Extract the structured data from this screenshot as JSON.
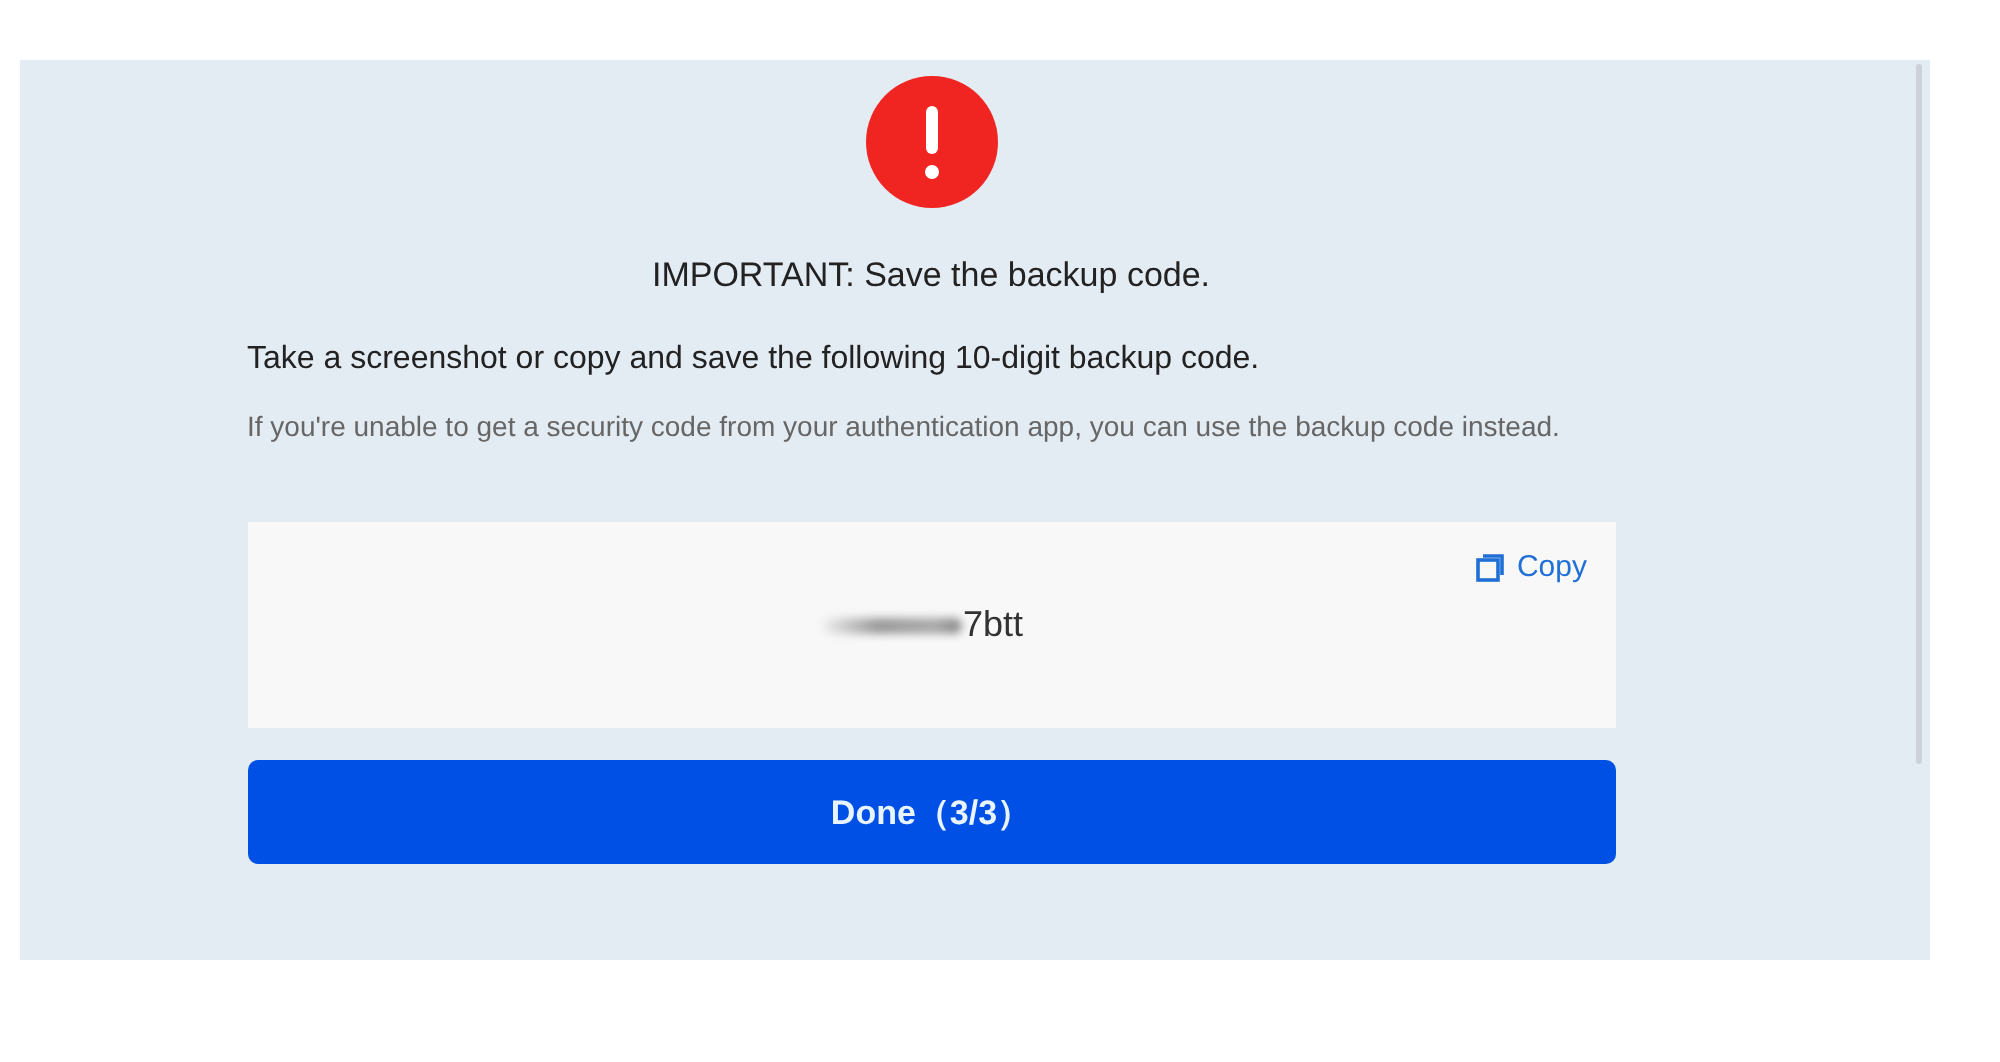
{
  "title": "IMPORTANT: Save the backup code.",
  "instruction": "Take a screenshot or copy and save the following 10-digit backup code.",
  "hint": "If you're unable to get a security code from your authentication app, you can use the backup code instead.",
  "code_card": {
    "copy_label": "Copy",
    "code": "7btt",
    "redacted": true
  },
  "done_button": "Done（3/3）"
}
